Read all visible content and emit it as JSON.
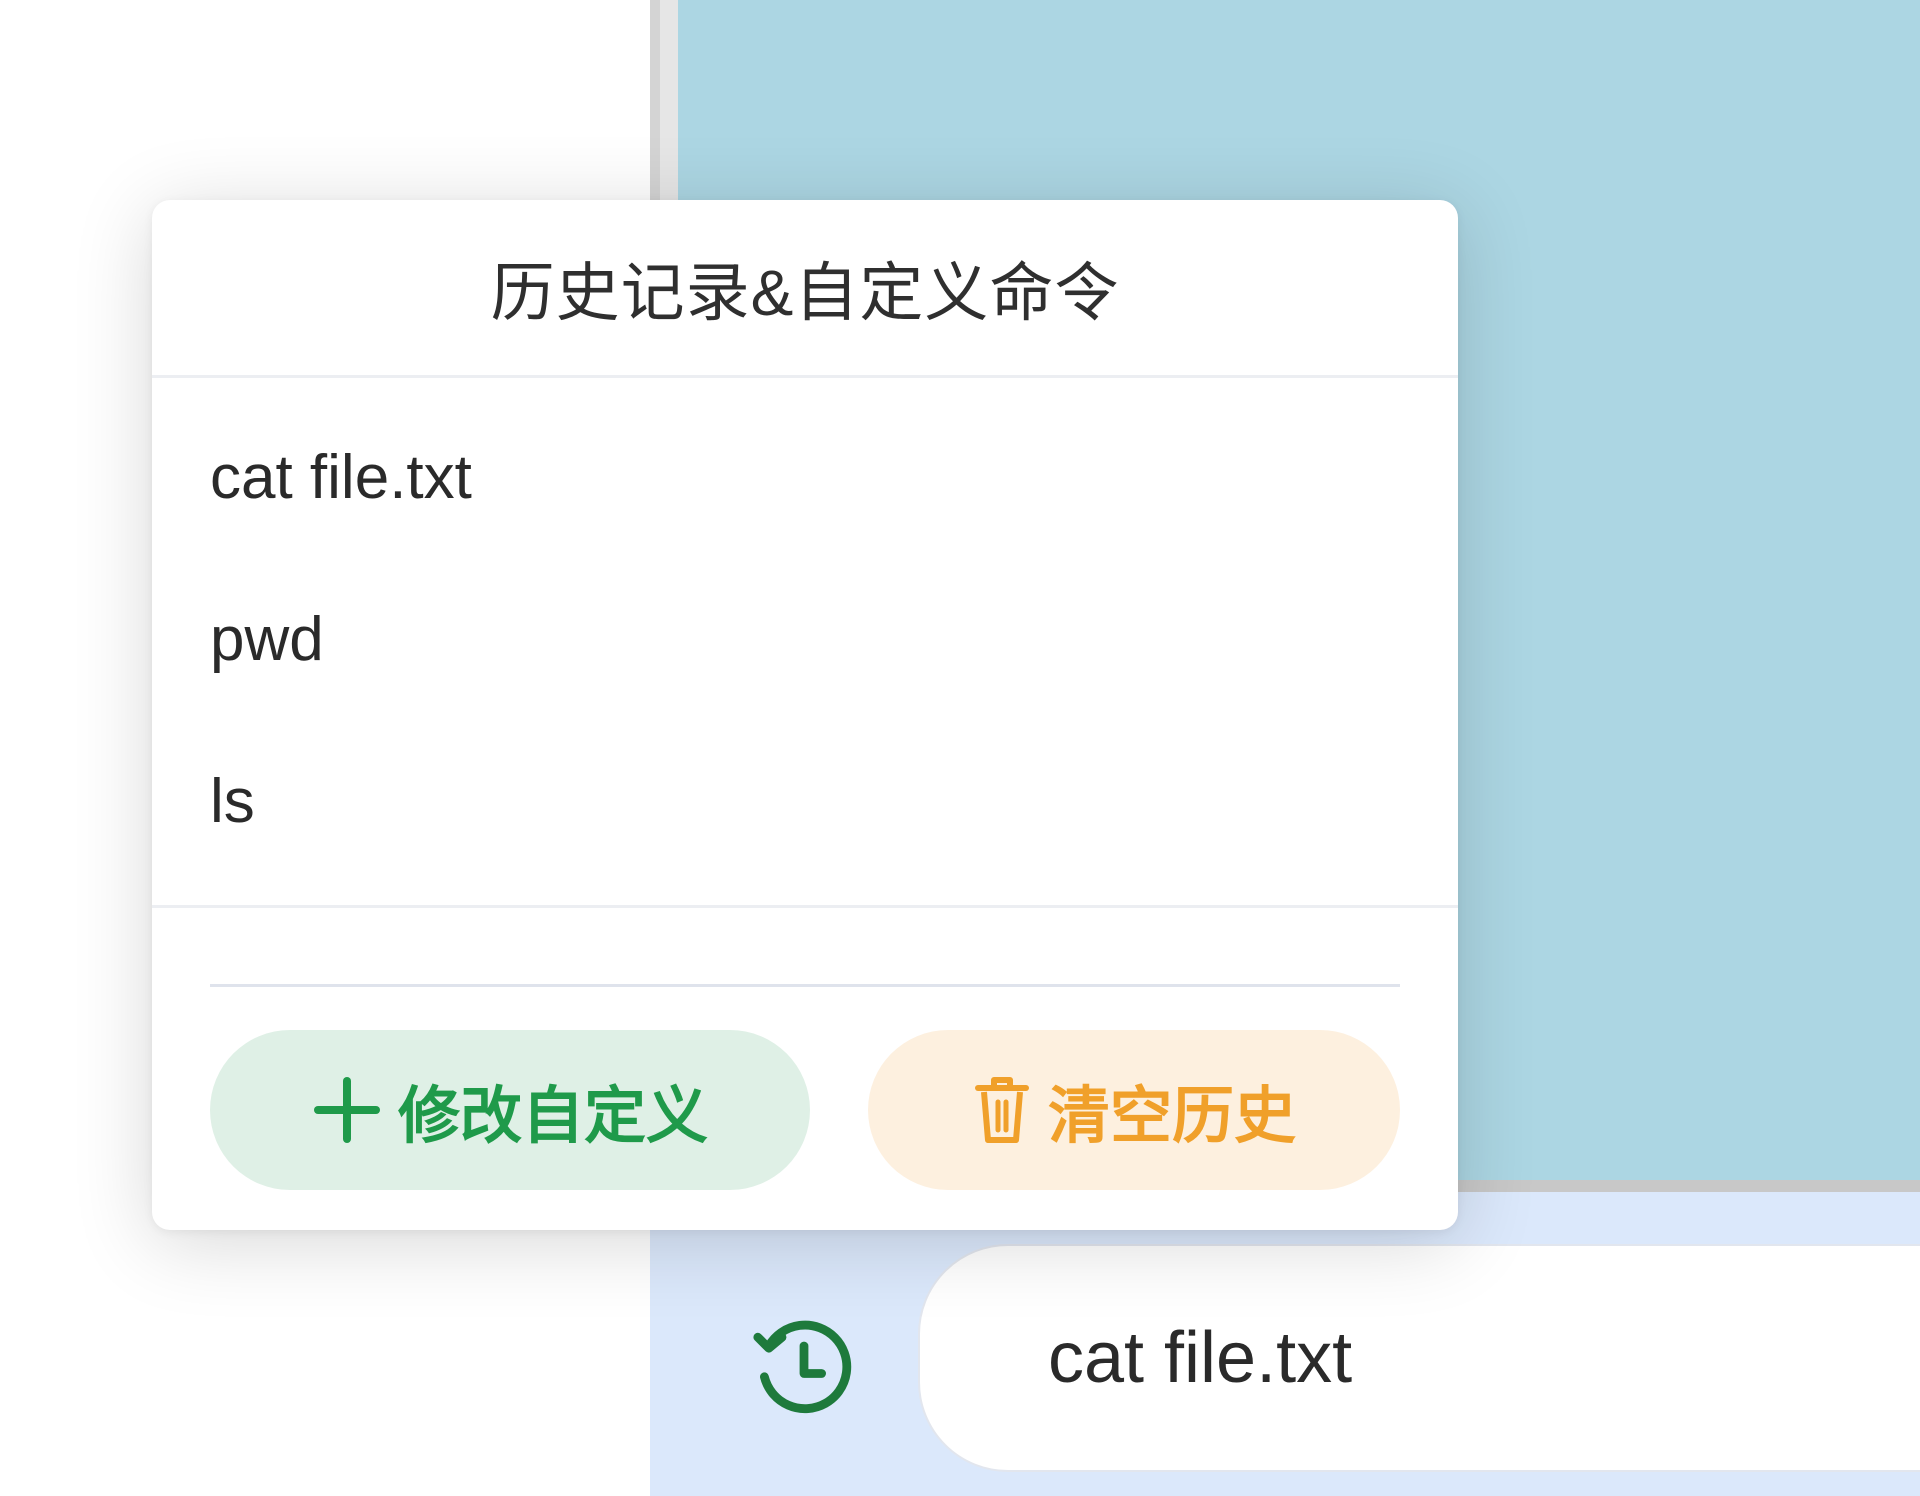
{
  "popover": {
    "title": "历史记录&自定义命令",
    "history_items": [
      "cat file.txt",
      "pwd",
      "ls"
    ],
    "edit_custom_label": "修改自定义",
    "clear_history_label": "清空历史"
  },
  "input_bar": {
    "command_value": "cat file.txt",
    "history_icon": "history-clock-icon"
  },
  "colors": {
    "terminal_bg": "#acd6e3",
    "input_bar_bg": "#dbe8fb",
    "edit_btn_bg": "#dff0e6",
    "edit_btn_text": "#1f9a4a",
    "clear_btn_bg": "#fdf0df",
    "clear_btn_text": "#f0a02a",
    "history_icon": "#1e7a3c"
  },
  "icons": {
    "edit": "plus-icon",
    "clear": "trash-icon"
  }
}
